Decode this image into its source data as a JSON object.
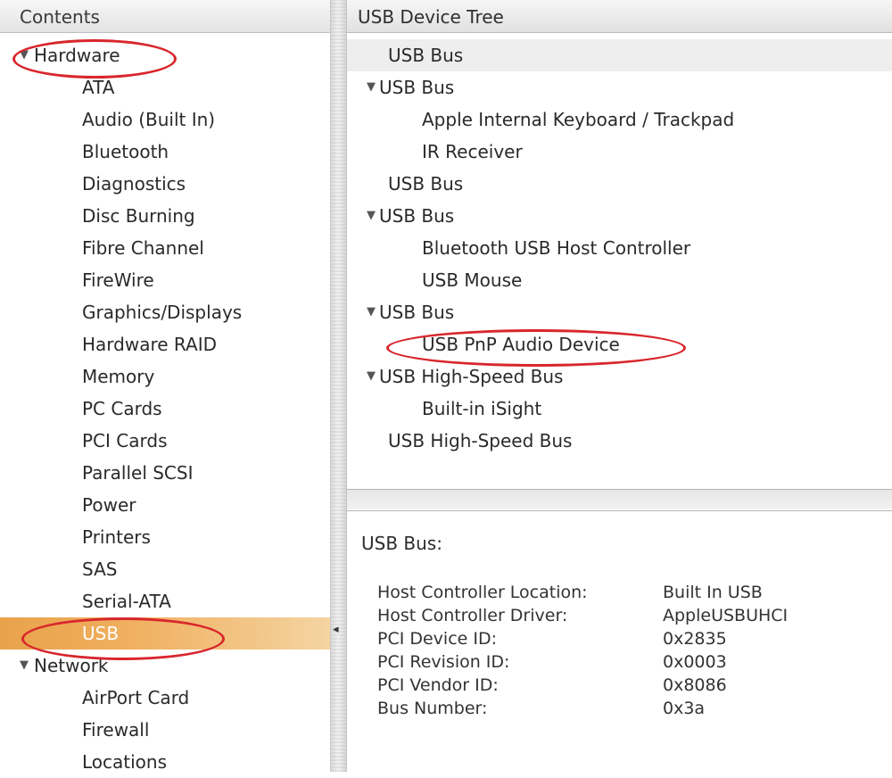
{
  "contents_pane": {
    "title": "Contents",
    "hardware_group": "Hardware",
    "hardware_items": [
      "ATA",
      "Audio (Built In)",
      "Bluetooth",
      "Diagnostics",
      "Disc Burning",
      "Fibre Channel",
      "FireWire",
      "Graphics/Displays",
      "Hardware RAID",
      "Memory",
      "PC Cards",
      "PCI Cards",
      "Parallel SCSI",
      "Power",
      "Printers",
      "SAS",
      "Serial-ATA",
      "USB"
    ],
    "selected_item": "USB",
    "network_group": "Network",
    "network_items": [
      "AirPort Card",
      "Firewall",
      "Locations"
    ]
  },
  "device_tree": {
    "title": "USB Device Tree",
    "rows": [
      {
        "label": "USB Bus",
        "indent": 0,
        "expanded": false
      },
      {
        "label": "USB Bus",
        "indent": 0,
        "expanded": true
      },
      {
        "label": "Apple Internal Keyboard / Trackpad",
        "indent": 1,
        "expanded": false
      },
      {
        "label": "IR Receiver",
        "indent": 1,
        "expanded": false
      },
      {
        "label": "USB Bus",
        "indent": 0,
        "expanded": false
      },
      {
        "label": "USB Bus",
        "indent": 0,
        "expanded": true
      },
      {
        "label": "Bluetooth USB Host Controller",
        "indent": 1,
        "expanded": false
      },
      {
        "label": "USB Mouse",
        "indent": 1,
        "expanded": false
      },
      {
        "label": "USB Bus",
        "indent": 0,
        "expanded": true
      },
      {
        "label": "USB PnP Audio Device",
        "indent": 1,
        "expanded": false
      },
      {
        "label": "USB High-Speed Bus",
        "indent": 0,
        "expanded": true
      },
      {
        "label": "Built-in iSight",
        "indent": 1,
        "expanded": false
      },
      {
        "label": "USB High-Speed Bus",
        "indent": 0,
        "expanded": false
      }
    ]
  },
  "detail": {
    "title": "USB Bus:",
    "properties": [
      {
        "key": "Host Controller Location:",
        "value": "Built In USB"
      },
      {
        "key": "Host Controller Driver:",
        "value": "AppleUSBUHCI"
      },
      {
        "key": "PCI Device ID:",
        "value": "0x2835"
      },
      {
        "key": "PCI Revision ID:",
        "value": "0x0003"
      },
      {
        "key": "PCI Vendor ID:",
        "value": "0x8086"
      },
      {
        "key": "Bus Number:",
        "value": "0x3a"
      }
    ]
  },
  "colors": {
    "highlight_oval": "#d8262c",
    "selection": "#f0b060"
  },
  "icons": {
    "expanded": "disclosure-triangle-down-icon"
  }
}
